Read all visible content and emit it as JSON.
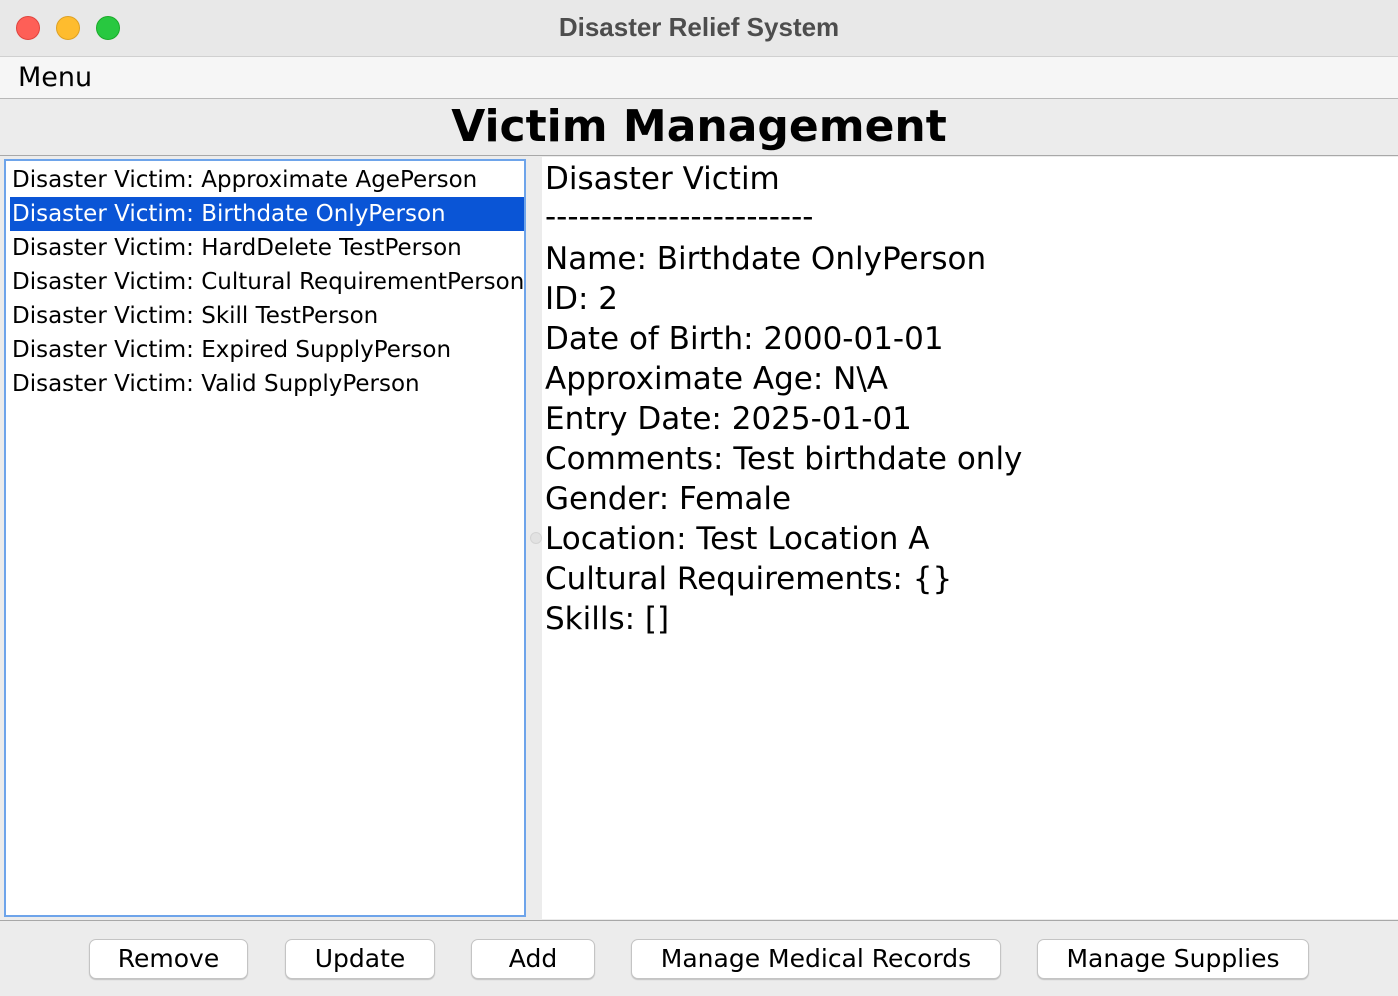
{
  "window": {
    "title": "Disaster Relief System"
  },
  "menubar": {
    "menu_label": "Menu"
  },
  "page": {
    "heading": "Victim Management"
  },
  "victim_list": {
    "selected_index": 1,
    "items": [
      "Disaster Victim: Approximate AgePerson",
      "Disaster Victim: Birthdate OnlyPerson",
      "Disaster Victim: HardDelete TestPerson",
      "Disaster Victim: Cultural RequirementPerson",
      "Disaster Victim: Skill TestPerson",
      "Disaster Victim: Expired SupplyPerson",
      "Disaster Victim: Valid SupplyPerson"
    ]
  },
  "details": {
    "lines": [
      "Disaster Victim",
      "------------------------",
      "Name: Birthdate OnlyPerson",
      "ID: 2",
      "Date of Birth: 2000-01-01",
      "Approximate Age: N\\A",
      "Entry Date: 2025-01-01",
      "Comments: Test birthdate only",
      "Gender: Female",
      "Location: Test Location A",
      "Cultural Requirements: {}",
      "Skills: []"
    ]
  },
  "buttons": {
    "remove": "Remove",
    "update": "Update",
    "add": "Add",
    "manage_medical": "Manage Medical Records",
    "manage_supplies": "Manage Supplies"
  },
  "colors": {
    "selection": "#0a55d6",
    "list_border": "#6ea4ea",
    "close": "#fe5f57",
    "minimize": "#febc2e",
    "maximize": "#28c840"
  }
}
